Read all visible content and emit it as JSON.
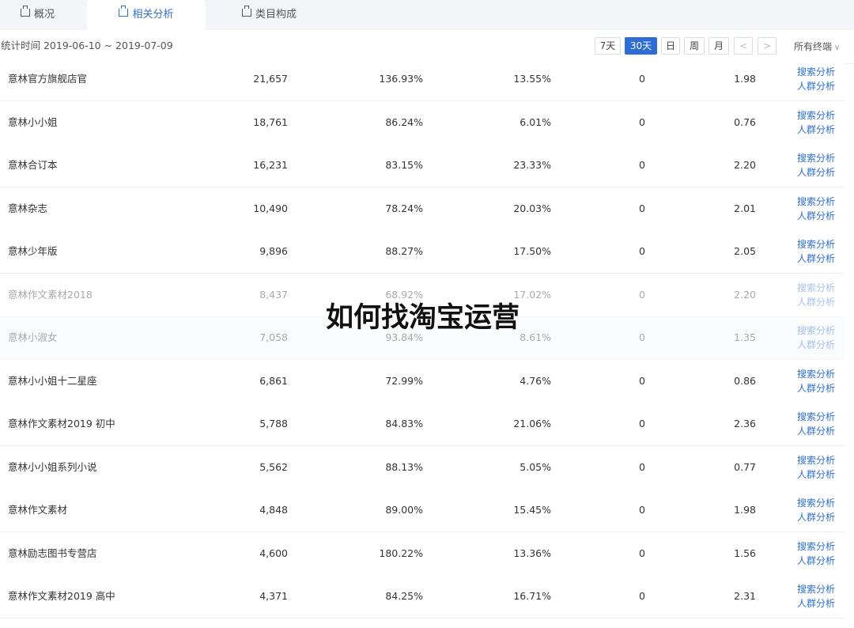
{
  "tabs": [
    {
      "label": "概况"
    },
    {
      "label": "相关分析"
    },
    {
      "label": "类目构成"
    }
  ],
  "toolbar": {
    "date_range": "统计时间 2019-06-10 ~ 2019-07-09",
    "period_buttons": [
      "7天",
      "30天",
      "日",
      "周",
      "月"
    ],
    "active_period": "30天",
    "prev_glyph": "<",
    "next_glyph": ">",
    "terminal_select": "所有终端",
    "chevron_glyph": "∨"
  },
  "row_actions": {
    "search": "搜索分析",
    "crowd": "人群分析"
  },
  "rows": [
    {
      "name": "意林官方旗舰店官",
      "n": "21,657",
      "p1": "136.93%",
      "p2": "13.55%",
      "z": "0",
      "d": "1.98"
    },
    {
      "name": "意林小小姐",
      "n": "18,761",
      "p1": "86.24%",
      "p2": "6.01%",
      "z": "0",
      "d": "0.76"
    },
    {
      "name": "意林合订本",
      "n": "16,231",
      "p1": "83.15%",
      "p2": "23.33%",
      "z": "0",
      "d": "2.20"
    },
    {
      "name": "意林杂志",
      "n": "10,490",
      "p1": "78.24%",
      "p2": "20.03%",
      "z": "0",
      "d": "2.01"
    },
    {
      "name": "意林少年版",
      "n": "9,896",
      "p1": "88.27%",
      "p2": "17.50%",
      "z": "0",
      "d": "2.05"
    },
    {
      "name": "意林作文素材2018",
      "n": "8,437",
      "p1": "68.92%",
      "p2": "17.02%",
      "z": "0",
      "d": "2.20"
    },
    {
      "name": "意林小淑女",
      "n": "7,058",
      "p1": "93.84%",
      "p2": "8.61%",
      "z": "0",
      "d": "1.35"
    },
    {
      "name": "意林小小姐十二星座",
      "n": "6,861",
      "p1": "72.99%",
      "p2": "4.76%",
      "z": "0",
      "d": "0.86"
    },
    {
      "name": "意林作文素材2019 初中",
      "n": "5,788",
      "p1": "84.83%",
      "p2": "21.06%",
      "z": "0",
      "d": "2.36"
    },
    {
      "name": "意林小小姐系列小说",
      "n": "5,562",
      "p1": "88.13%",
      "p2": "5.05%",
      "z": "0",
      "d": "0.77"
    },
    {
      "name": "意林作文素材",
      "n": "4,848",
      "p1": "89.00%",
      "p2": "15.45%",
      "z": "0",
      "d": "1.98"
    },
    {
      "name": "意林励志图书专营店",
      "n": "4,600",
      "p1": "180.22%",
      "p2": "13.36%",
      "z": "0",
      "d": "1.56"
    },
    {
      "name": "意林作文素材2019 高中",
      "n": "4,371",
      "p1": "84.25%",
      "p2": "16.71%",
      "z": "0",
      "d": "2.31"
    }
  ],
  "overlay_text": "如何找淘宝运营",
  "colors": {
    "accent": "#2d6ed6",
    "tab_bar": "#f3f5f9",
    "border": "#eef0f3"
  }
}
